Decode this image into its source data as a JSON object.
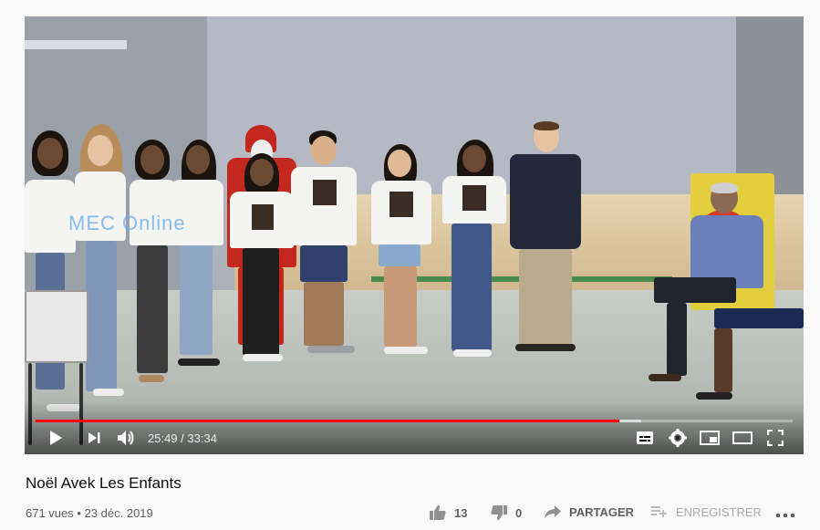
{
  "video": {
    "watermark": "MEC Online",
    "time_current": "25:49",
    "time_separator": "/",
    "time_total": "33:34",
    "progress_played": 0.771,
    "progress_loaded": 0.8,
    "accent_color": "#ff0000"
  },
  "controls": {
    "icons": [
      "play-icon",
      "next-icon",
      "volume-icon",
      "subtitles-icon",
      "settings-icon",
      "miniplayer-icon",
      "theater-icon",
      "fullscreen-icon"
    ]
  },
  "info": {
    "title": "Noël Avek Les Enfants",
    "views": "671 vues",
    "separator": "•",
    "date": "23 déc. 2019"
  },
  "actions": {
    "like_count": "13",
    "dislike_count": "0",
    "share_label": "PARTAGER",
    "save_label": "ENREGISTRER"
  }
}
